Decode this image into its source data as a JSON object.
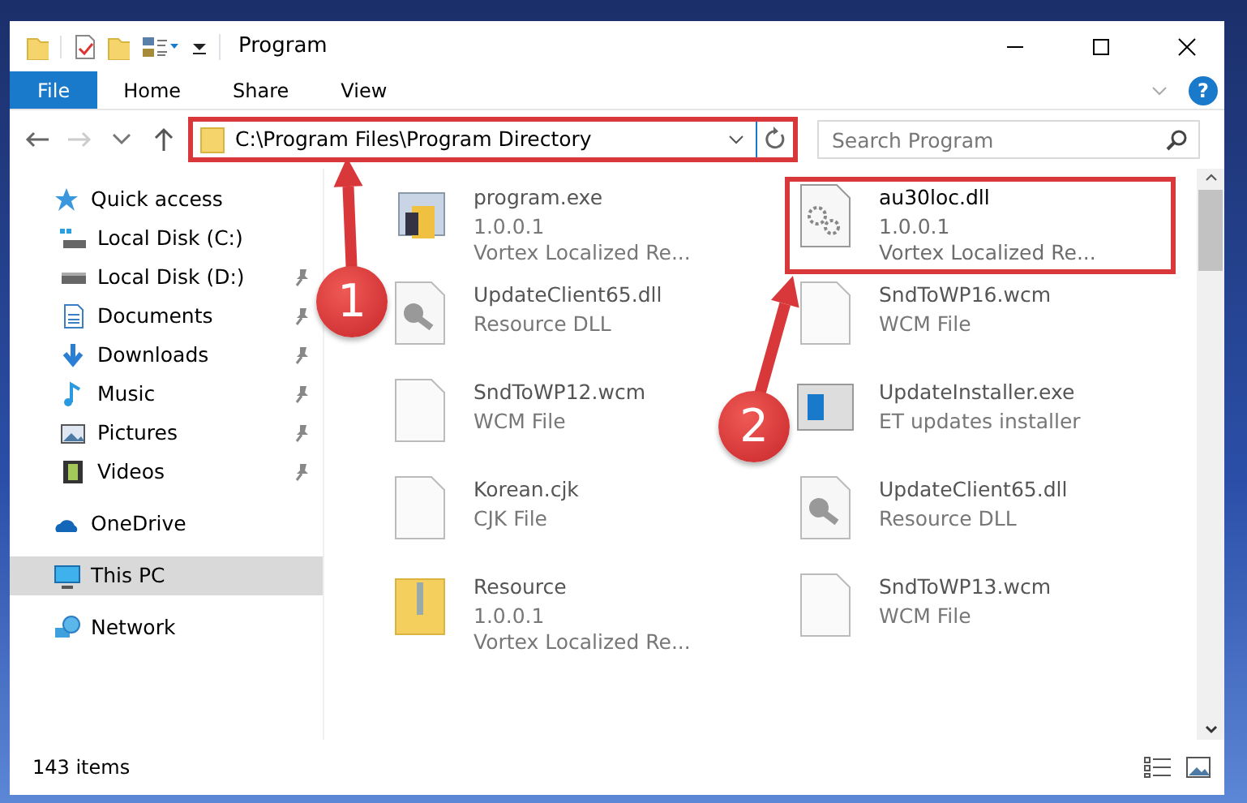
{
  "window": {
    "title": "Program"
  },
  "ribbon": {
    "tabs": [
      {
        "label": "File",
        "kind": "file"
      },
      {
        "label": "Home",
        "kind": "tab"
      },
      {
        "label": "Share",
        "kind": "tab"
      },
      {
        "label": "View",
        "kind": "tab"
      }
    ],
    "help": "?"
  },
  "address_bar": {
    "path": "C:\\Program Files\\Program Directory",
    "highlighted": true
  },
  "search": {
    "placeholder": "Search Program"
  },
  "navigation": [
    {
      "label": "Quick access",
      "selected": false,
      "children": [
        {
          "label": "Local Disk (C:)",
          "pinned": false,
          "selected": false
        },
        {
          "label": "Local Disk (D:)",
          "pinned": true,
          "selected": false
        },
        {
          "label": "Documents",
          "pinned": true,
          "selected": false
        },
        {
          "label": "Downloads",
          "pinned": true,
          "selected": false
        },
        {
          "label": "Music",
          "pinned": true,
          "selected": false
        },
        {
          "label": "Pictures",
          "pinned": true,
          "selected": false
        },
        {
          "label": "Videos",
          "pinned": true,
          "selected": false
        }
      ]
    },
    {
      "label": "OneDrive",
      "selected": false
    },
    {
      "label": "This PC",
      "selected": true
    },
    {
      "label": "Network",
      "selected": false
    }
  ],
  "files": [
    {
      "name": "program.exe",
      "lines": [
        "1.0.0.1",
        "Vortex Localized Re..."
      ],
      "kind": "exe",
      "highlighted": false
    },
    {
      "name": "au30loc.dll",
      "lines": [
        "1.0.0.1",
        "Vortex Localized Re..."
      ],
      "kind": "dll",
      "highlighted": true
    },
    {
      "name": "UpdateClient65.dll",
      "lines": [
        "Resource DLL"
      ],
      "kind": "resource",
      "highlighted": false
    },
    {
      "name": "SndToWP16.wcm",
      "lines": [
        "WCM File"
      ],
      "kind": "doc",
      "highlighted": false
    },
    {
      "name": "SndToWP12.wcm",
      "lines": [
        "WCM File"
      ],
      "kind": "doc",
      "highlighted": false
    },
    {
      "name": "UpdateInstaller.exe",
      "lines": [
        "ET updates installer"
      ],
      "kind": "installer",
      "highlighted": false
    },
    {
      "name": "Korean.cjk",
      "lines": [
        "CJK File"
      ],
      "kind": "doc",
      "highlighted": false
    },
    {
      "name": "UpdateClient65.dll",
      "lines": [
        "Resource DLL"
      ],
      "kind": "resource",
      "highlighted": false
    },
    {
      "name": "Resource",
      "lines": [
        "1.0.0.1",
        "Vortex Localized Re..."
      ],
      "kind": "archive",
      "highlighted": false
    },
    {
      "name": "SndToWP13.wcm",
      "lines": [
        "WCM File"
      ],
      "kind": "doc",
      "highlighted": false
    }
  ],
  "annotations": [
    {
      "label": "1"
    },
    {
      "label": "2"
    }
  ],
  "status_bar": {
    "count": "143 items"
  }
}
